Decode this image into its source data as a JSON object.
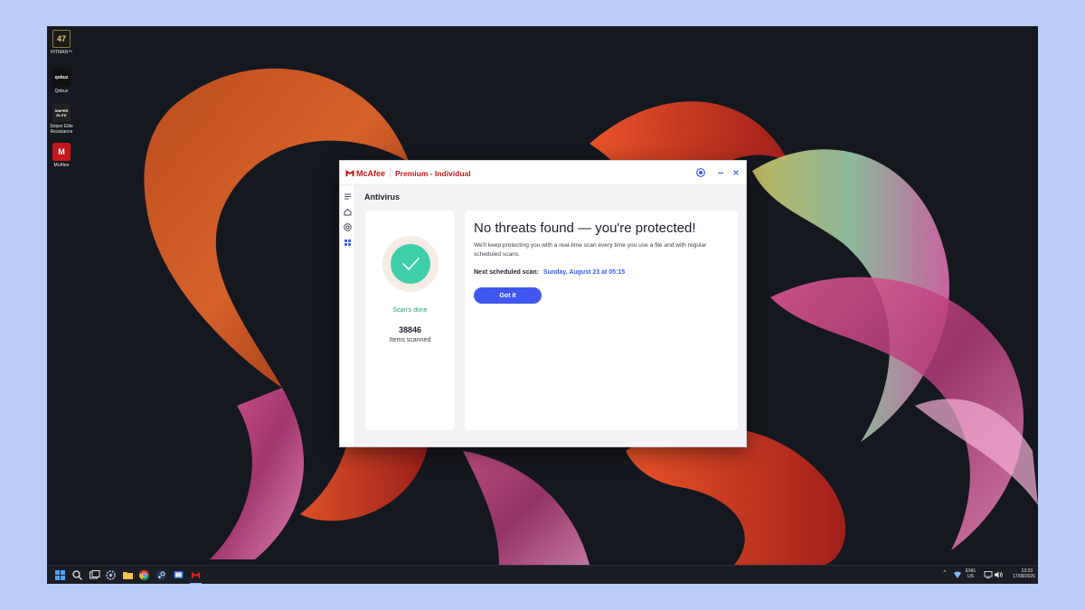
{
  "desktop": {
    "icons": [
      {
        "label": "HITMAN™",
        "glyph": "47",
        "color": "#1a1a1a"
      },
      {
        "label": "Qobuz",
        "glyph": "qobuz",
        "color": "#111111"
      },
      {
        "label": "Sniper Elite Resistance",
        "glyph": "SNIPER ELITE",
        "color": "#222222"
      },
      {
        "label": "McAfee",
        "glyph": "M",
        "color": "#c3161c"
      }
    ]
  },
  "window": {
    "brand": "McAfee",
    "edition": "Premium - Individual",
    "controls": {
      "help_icon": "help-icon",
      "minimize_icon": "minimize-icon",
      "close_icon": "close-icon"
    }
  },
  "sidebar": {
    "items": [
      {
        "name": "menu-icon"
      },
      {
        "name": "home-icon"
      },
      {
        "name": "protection-icon"
      },
      {
        "name": "apps-grid-icon"
      }
    ]
  },
  "page": {
    "title": "Antivirus"
  },
  "scan_summary": {
    "status": "Scan's done",
    "items_count": "38846",
    "items_label": "Items scanned"
  },
  "result": {
    "headline": "No threats found — you're protected!",
    "description": "We'll keep protecting you with a real-time scan every time you use a file and with regular scheduled scans.",
    "next_scan_label": "Next scheduled scan:",
    "next_scan_date": "Sunday, August 23 at 05:15",
    "button_label": "Got it"
  },
  "taskbar": {
    "language": "ENG",
    "region": "US",
    "time": "13:33",
    "date": "17/08/2026"
  },
  "colors": {
    "accent": "#4158f0",
    "brand_red": "#c01818",
    "success": "#3fcfa8"
  }
}
